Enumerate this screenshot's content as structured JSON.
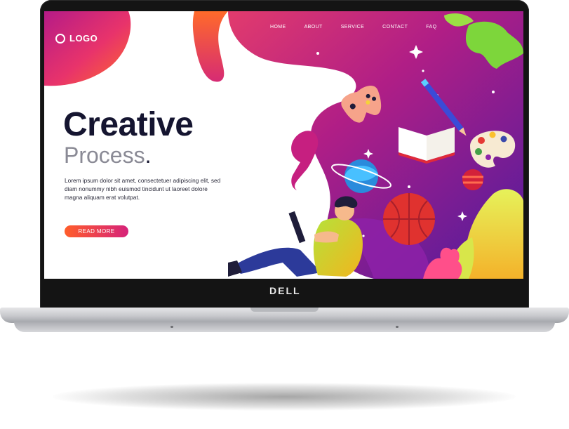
{
  "site": {
    "logo_text": "LOGO",
    "nav": [
      {
        "label": "HOME"
      },
      {
        "label": "ABOUT"
      },
      {
        "label": "SERVICE"
      },
      {
        "label": "CONTACT"
      },
      {
        "label": "FAQ"
      }
    ],
    "headline": "Creative",
    "subhead": "Process",
    "subhead_dot": ".",
    "body": "Lorem ipsum dolor sit amet, consectetuer adipiscing elit, sed diam nonummy nibh euismod tincidunt ut laoreet dolore magna aliquam erat volutpat.",
    "cta_label": "READ MORE"
  },
  "laptop": {
    "brand": "DELL"
  },
  "colors": {
    "accent_orange": "#ff5d2a",
    "accent_pink": "#d6227a",
    "accent_purple": "#7a1fb0",
    "headline": "#151530"
  }
}
